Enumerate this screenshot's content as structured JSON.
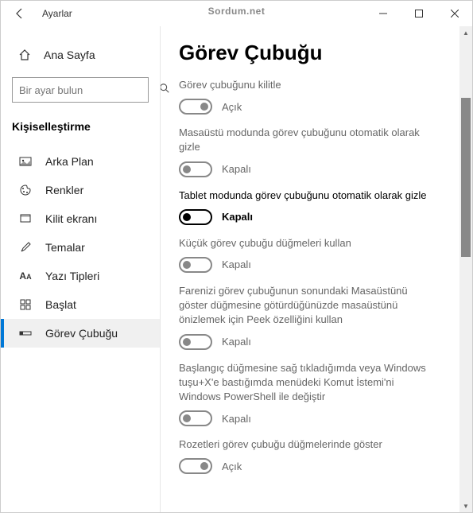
{
  "titlebar": {
    "title": "Ayarlar"
  },
  "watermark": "Sordum.net",
  "sidebar": {
    "home": "Ana Sayfa",
    "search_placeholder": "Bir ayar bulun",
    "section": "Kişiselleştirme",
    "items": [
      {
        "label": "Arka Plan"
      },
      {
        "label": "Renkler"
      },
      {
        "label": "Kilit ekranı"
      },
      {
        "label": "Temalar"
      },
      {
        "label": "Yazı Tipleri"
      },
      {
        "label": "Başlat"
      },
      {
        "label": "Görev Çubuğu"
      }
    ]
  },
  "main": {
    "heading": "Görev Çubuğu",
    "settings": [
      {
        "label": "Görev çubuğunu kilitle",
        "state": "Açık",
        "style": "gray",
        "toggle": "on-right"
      },
      {
        "label": "Masaüstü modunda görev çubuğunu otomatik olarak gizle",
        "state": "Kapalı",
        "style": "gray",
        "toggle": "off"
      },
      {
        "label": "Tablet modunda görev çubuğunu otomatik olarak gizle",
        "state": "Kapalı",
        "style": "dark",
        "toggle": "on-dark"
      },
      {
        "label": "Küçük görev çubuğu düğmeleri kullan",
        "state": "Kapalı",
        "style": "gray",
        "toggle": "off"
      },
      {
        "label": "Farenizi görev çubuğunun sonundaki Masaüstünü göster düğmesine götürdüğünüzde masaüstünü önizlemek için Peek özelliğini kullan",
        "state": "Kapalı",
        "style": "gray",
        "toggle": "off"
      },
      {
        "label": "Başlangıç düğmesine sağ tıkladığımda veya Windows tuşu+X'e bastığımda menüdeki Komut İstemi'ni Windows PowerShell ile değiştir",
        "state": "Kapalı",
        "style": "gray",
        "toggle": "off"
      },
      {
        "label": "Rozetleri görev çubuğu düğmelerinde göster",
        "state": "Açık",
        "style": "gray",
        "toggle": "on-right"
      }
    ]
  }
}
